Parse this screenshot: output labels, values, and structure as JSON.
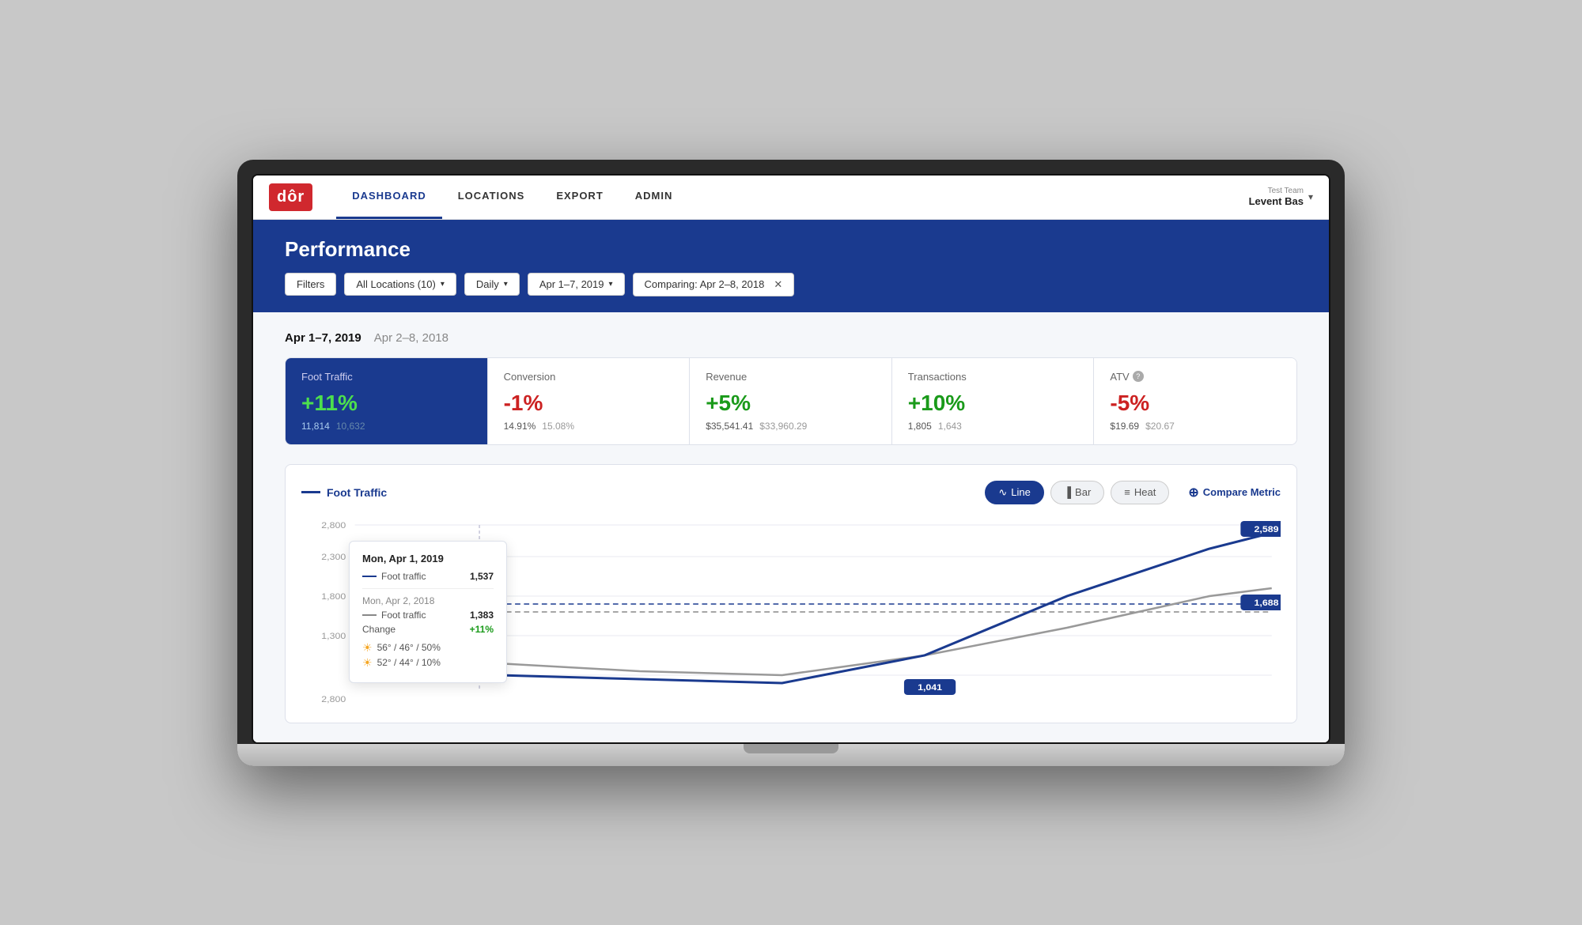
{
  "nav": {
    "logo": "dôr",
    "links": [
      {
        "label": "DASHBOARD",
        "active": true
      },
      {
        "label": "LOCATIONS",
        "active": false
      },
      {
        "label": "EXPORT",
        "active": false
      },
      {
        "label": "ADMIN",
        "active": false
      }
    ],
    "user": {
      "team": "Test Team",
      "name": "Levent Bas"
    }
  },
  "performance": {
    "title": "Performance",
    "filters": {
      "filters_label": "Filters",
      "locations_label": "All Locations (10)",
      "period_label": "Daily",
      "date_range_label": "Apr 1–7, 2019",
      "comparing_label": "Comparing: Apr 2–8, 2018"
    },
    "date_primary": "Apr 1–7, 2019",
    "date_secondary": "Apr 2–8, 2018",
    "metrics": [
      {
        "label": "Foot Traffic",
        "active": true,
        "pct": "+11%",
        "pct_type": "positive",
        "val_current": "11,814",
        "val_prev": "10,632"
      },
      {
        "label": "Conversion",
        "active": false,
        "pct": "-1%",
        "pct_type": "negative",
        "val_current": "14.91%",
        "val_prev": "15.08%"
      },
      {
        "label": "Revenue",
        "active": false,
        "pct": "+5%",
        "pct_type": "positive",
        "val_current": "$35,541.41",
        "val_prev": "$33,960.29"
      },
      {
        "label": "Transactions",
        "active": false,
        "pct": "+10%",
        "pct_type": "positive",
        "val_current": "1,805",
        "val_prev": "1,643"
      },
      {
        "label": "ATV",
        "active": false,
        "has_info": true,
        "pct": "-5%",
        "pct_type": "negative",
        "val_current": "$19.69",
        "val_prev": "$20.67"
      }
    ]
  },
  "chart": {
    "title": "Foot Traffic",
    "type_buttons": [
      {
        "label": "Line",
        "icon": "line-icon",
        "active": true
      },
      {
        "label": "Bar",
        "icon": "bar-icon",
        "active": false
      },
      {
        "label": "Heat",
        "icon": "heat-icon",
        "active": false
      }
    ],
    "compare_label": "Compare Metric",
    "y_labels": [
      "2,800",
      "2,300",
      "1,800",
      "1,300",
      "2,800"
    ],
    "balloon_top": "2,589",
    "balloon_mid": "1,688",
    "balloon_low": "1,041",
    "tooltip": {
      "date1": "Mon, Apr 1, 2019",
      "line1_label": "Foot traffic",
      "line1_value": "1,537",
      "date2": "Mon, Apr 2, 2018",
      "line2_label": "Foot traffic",
      "line2_value": "1,383",
      "change_label": "Change",
      "change_value": "+11%",
      "weather1": "56° / 46° / 50%",
      "weather2": "52° / 44° / 10%"
    }
  }
}
